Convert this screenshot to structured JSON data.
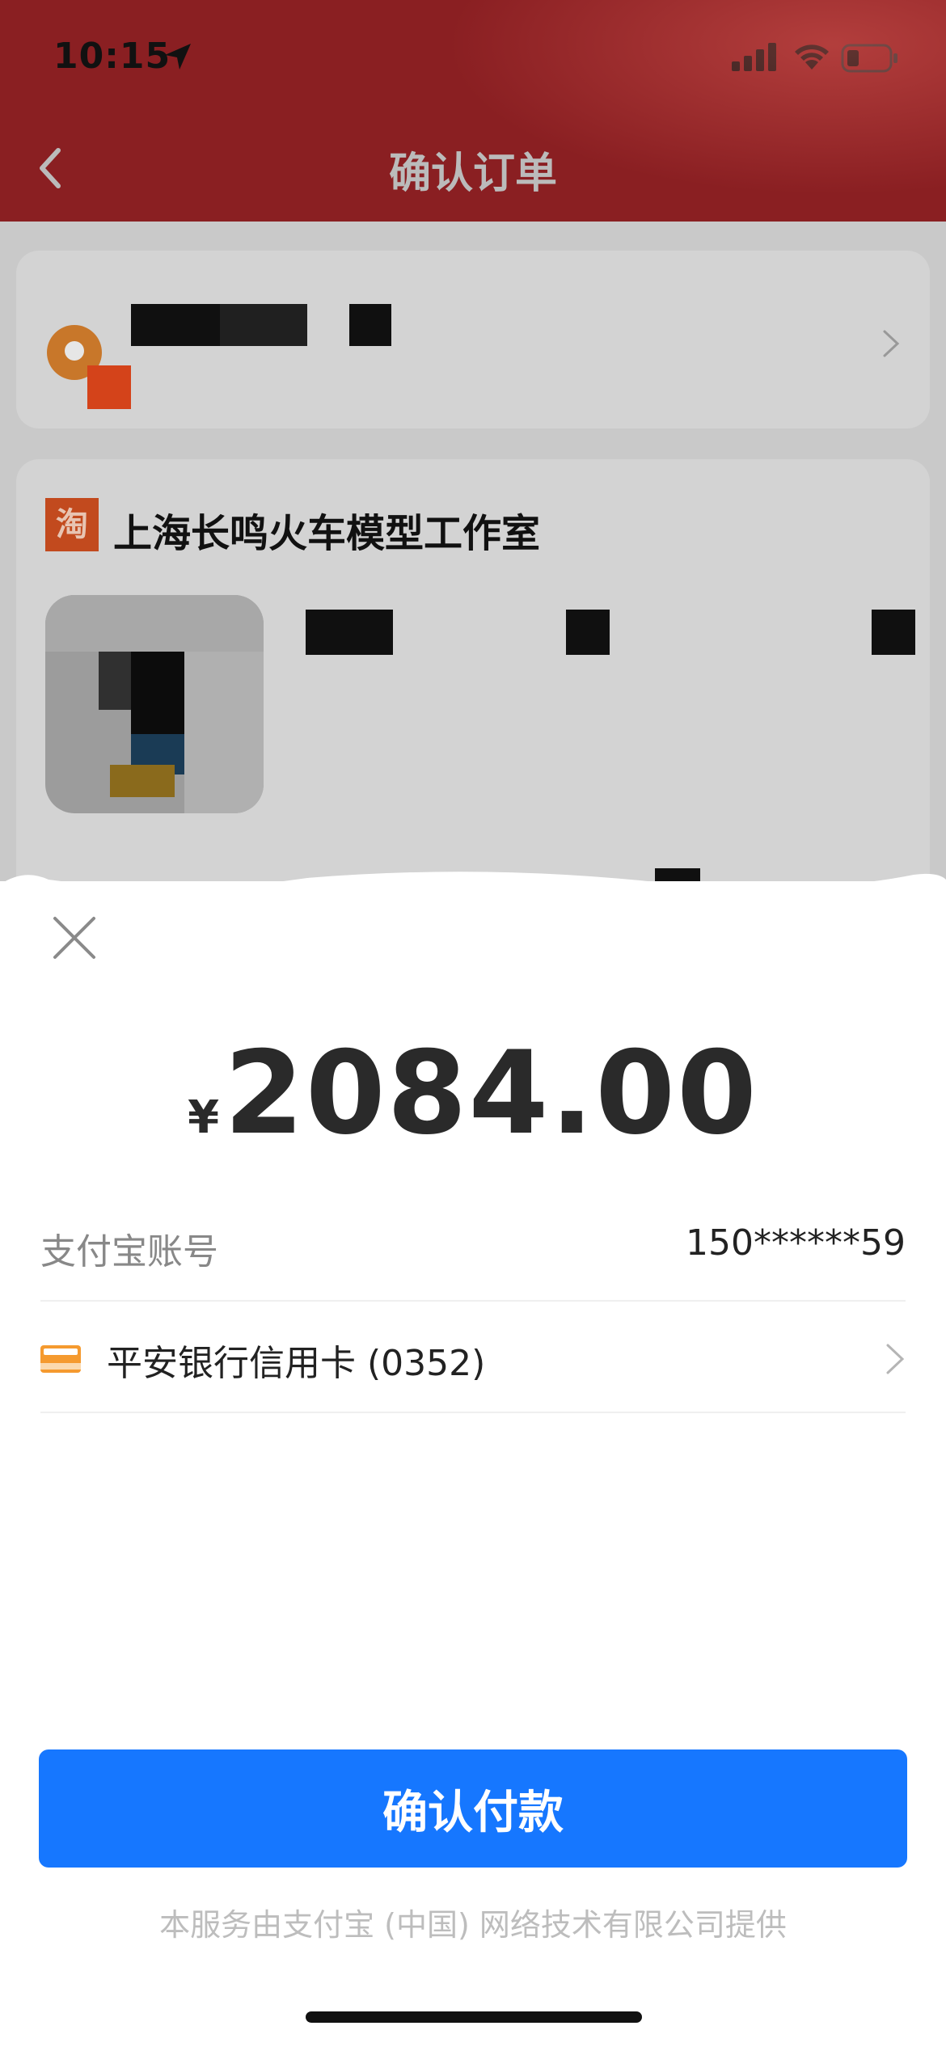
{
  "status_bar": {
    "time": "10:15"
  },
  "nav": {
    "title": "确认订单"
  },
  "order": {
    "shop_name": "上海长鸣火车模型工作室",
    "shop_badge": "淘"
  },
  "payment": {
    "currency_symbol": "¥",
    "amount": "2084.00",
    "account_label": "支付宝账号",
    "account_value": "150******59",
    "method_label": "平安银行信用卡 (0352)",
    "confirm_label": "确认付款",
    "footer_note": "本服务由支付宝 (中国) 网络技术有限公司提供"
  },
  "colors": {
    "primary_button": "#1677ff",
    "header_red": "#8a1f22",
    "card_icon_orange": "#f59a2f"
  },
  "icons": {
    "back": "chevron-left-icon",
    "close": "close-icon",
    "location": "location-pin-icon",
    "card": "credit-card-icon",
    "row_chevron": "chevron-right-icon"
  }
}
